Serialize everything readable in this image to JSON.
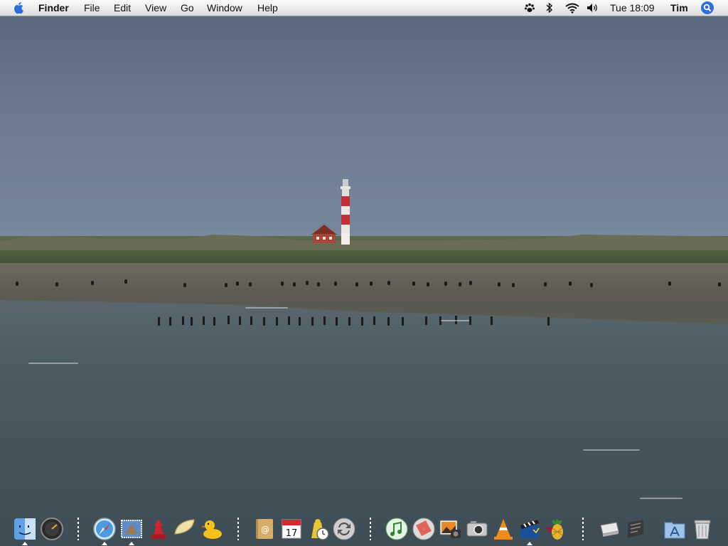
{
  "menubar": {
    "apple_icon": "apple-icon",
    "app_name": "Finder",
    "menus": [
      "File",
      "Edit",
      "View",
      "Go",
      "Window",
      "Help"
    ],
    "status_icons": [
      "paw-icon",
      "bluetooth-icon",
      "wifi-icon",
      "volume-icon"
    ],
    "clock": "Tue 18:09",
    "user": "Tim",
    "spotlight_icon": "spotlight-icon"
  },
  "desktop": {
    "wallpaper": "lighthouse-beach-photo"
  },
  "dock": {
    "items": [
      {
        "name": "finder",
        "icon": "finder-icon",
        "running": true
      },
      {
        "name": "dashboard",
        "icon": "dashboard-icon",
        "running": false
      },
      {
        "name": "safari",
        "icon": "safari-icon",
        "running": true
      },
      {
        "name": "mail",
        "icon": "mail-icon",
        "running": true
      },
      {
        "name": "red-app",
        "icon": "red-chess-icon",
        "running": false
      },
      {
        "name": "tortilla",
        "icon": "tortilla-icon",
        "running": false
      },
      {
        "name": "cyberduck",
        "icon": "duck-icon",
        "running": false
      },
      {
        "name": "address-book",
        "icon": "address-book-icon",
        "running": false
      },
      {
        "name": "ical",
        "icon": "calendar-icon",
        "running": false
      },
      {
        "name": "time-machine",
        "icon": "clock-figure-icon",
        "running": false
      },
      {
        "name": "sync",
        "icon": "sync-icon",
        "running": false
      },
      {
        "name": "itunes",
        "icon": "itunes-icon",
        "running": false
      },
      {
        "name": "dvd-player",
        "icon": "dvd-icon",
        "running": false
      },
      {
        "name": "iphoto",
        "icon": "iphoto-icon",
        "running": false
      },
      {
        "name": "image-capture",
        "icon": "camera-icon",
        "running": false
      },
      {
        "name": "vlc",
        "icon": "vlc-cone-icon",
        "running": false
      },
      {
        "name": "imovie",
        "icon": "clapper-icon",
        "running": true
      },
      {
        "name": "adium",
        "icon": "pineapple-icon",
        "running": false
      },
      {
        "name": "disk-utility",
        "icon": "disk-icon",
        "running": false
      },
      {
        "name": "script",
        "icon": "script-icon",
        "running": false
      },
      {
        "name": "applications",
        "icon": "applications-folder-icon",
        "running": false
      },
      {
        "name": "trash",
        "icon": "trash-icon",
        "running": false
      }
    ],
    "calendar_day": "17"
  }
}
